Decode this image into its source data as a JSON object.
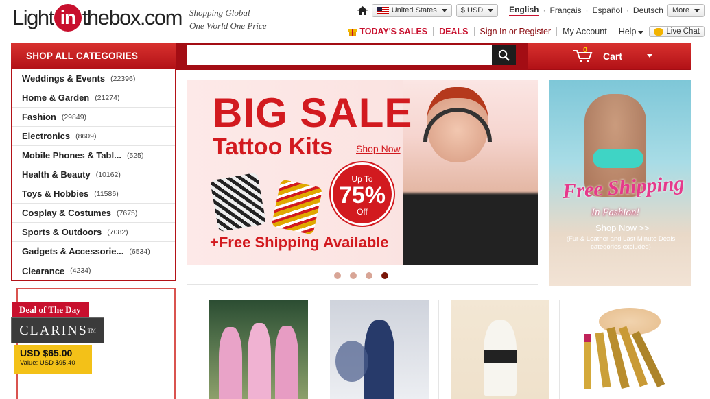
{
  "logo": {
    "part1": "Light",
    "part2": "in",
    "part3": "thebox",
    "part4": ".com"
  },
  "slogan": {
    "line1": "Shopping Global",
    "line2": "One World One Price"
  },
  "topbar": {
    "country": "United States",
    "currency": "$ USD",
    "languages": [
      "English",
      "Français",
      "Español",
      "Deutsch"
    ],
    "more": "More"
  },
  "nav": {
    "todays_sales": "TODAY'S SALES",
    "deals": "DEALS",
    "sign_in": "Sign In or Register",
    "my_account": "My Account",
    "help": "Help",
    "live_chat": "Live Chat"
  },
  "header": {
    "shop_all": "SHOP ALL CATEGORIES",
    "search_placeholder": "",
    "cart_label": "Cart",
    "cart_count": "0"
  },
  "categories": [
    {
      "name": "Weddings & Events",
      "count": "(22396)"
    },
    {
      "name": "Home & Garden",
      "count": "(21274)"
    },
    {
      "name": "Fashion",
      "count": "(29849)"
    },
    {
      "name": "Electronics",
      "count": "(8609)"
    },
    {
      "name": "Mobile Phones & Tabl...",
      "count": "(525)"
    },
    {
      "name": "Health & Beauty",
      "count": "(10162)"
    },
    {
      "name": "Toys & Hobbies",
      "count": "(11586)"
    },
    {
      "name": "Cosplay & Costumes",
      "count": "(7675)"
    },
    {
      "name": "Sports & Outdoors",
      "count": "(7082)"
    },
    {
      "name": "Gadgets & Accessorie...",
      "count": "(6534)"
    },
    {
      "name": "Clearance",
      "count": "(4234)"
    }
  ],
  "banner": {
    "big_sale": "BIG SALE",
    "tattoo_kits": "Tattoo Kits",
    "shop_now": "Shop Now",
    "up_to": "Up To",
    "percent": "75%",
    "off": "Off",
    "free_shipping": "+Free Shipping Available",
    "slide_active_index": 4
  },
  "side_banner": {
    "free_shipping": "Free Shipping",
    "in_fashion": "In Fashion!",
    "shop_now": "Shop Now >>",
    "note": "(Fur & Leather and Last Minute Deals categories excluded)"
  },
  "deal": {
    "tag": "Deal of The Day",
    "brand": "CLARINS",
    "tm": "TM",
    "price": "USD $65.00",
    "value": "Value: USD $95.40"
  },
  "colors": {
    "brand_red": "#c8102e",
    "dark_red": "#a30d14",
    "deal_yellow": "#f3c118"
  }
}
